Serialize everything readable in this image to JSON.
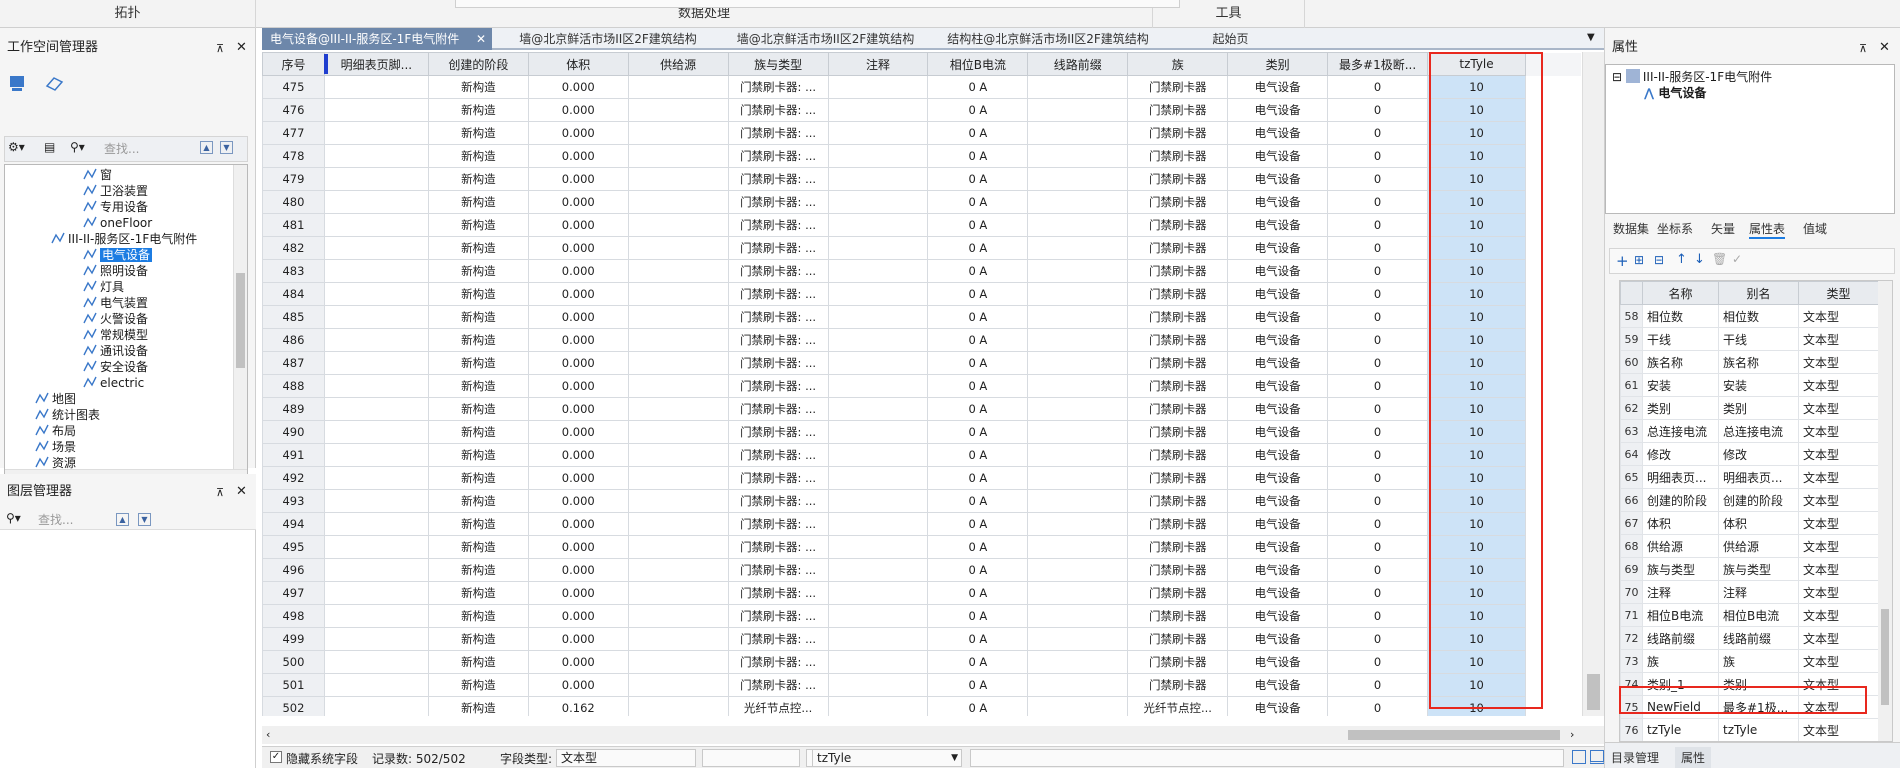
{
  "ribbon": {
    "group1": "拓扑",
    "group2": "数据处理",
    "group3": "工具"
  },
  "workspace": {
    "title": "工作空间管理器",
    "search_placeholder": "查找...",
    "tree": {
      "items_top": [
        "窗",
        "卫浴装置",
        "专用设备",
        "oneFloor"
      ],
      "dataset": "III-II-服务区-1F电气附件",
      "children": [
        "电气设备",
        "照明设备",
        "灯具",
        "电气装置",
        "火警设备",
        "常规模型",
        "通讯设备",
        "安全设备",
        "electric"
      ],
      "roots": [
        "地图",
        "统计图表",
        "布局",
        "场景",
        "资源"
      ]
    }
  },
  "layers": {
    "title": "图层管理器",
    "search_placeholder": "查找..."
  },
  "tabs": [
    "电气设备@III-II-服务区-1F电气附件",
    "墙@北京鲜活市场II区2F建筑结构",
    "墙@北京鲜活市场II区2F建筑结构",
    "结构柱@北京鲜活市场II区2F建筑结构",
    "起始页"
  ],
  "grid": {
    "headers": [
      "序号",
      "明细表页脚...",
      "创建的阶段",
      "体积",
      "供给源",
      "族与类型",
      "注释",
      "相位B电流",
      "线路前缀",
      "族",
      "类别",
      "最多#1极断...",
      "tzTyle"
    ],
    "rows": [
      [
        "475",
        "",
        "新构造",
        "0.000",
        "",
        "门禁刷卡器: ...",
        "",
        "0 A",
        "",
        "门禁刷卡器",
        "电气设备",
        "0",
        "10"
      ],
      [
        "476",
        "",
        "新构造",
        "0.000",
        "",
        "门禁刷卡器: ...",
        "",
        "0 A",
        "",
        "门禁刷卡器",
        "电气设备",
        "0",
        "10"
      ],
      [
        "477",
        "",
        "新构造",
        "0.000",
        "",
        "门禁刷卡器: ...",
        "",
        "0 A",
        "",
        "门禁刷卡器",
        "电气设备",
        "0",
        "10"
      ],
      [
        "478",
        "",
        "新构造",
        "0.000",
        "",
        "门禁刷卡器: ...",
        "",
        "0 A",
        "",
        "门禁刷卡器",
        "电气设备",
        "0",
        "10"
      ],
      [
        "479",
        "",
        "新构造",
        "0.000",
        "",
        "门禁刷卡器: ...",
        "",
        "0 A",
        "",
        "门禁刷卡器",
        "电气设备",
        "0",
        "10"
      ],
      [
        "480",
        "",
        "新构造",
        "0.000",
        "",
        "门禁刷卡器: ...",
        "",
        "0 A",
        "",
        "门禁刷卡器",
        "电气设备",
        "0",
        "10"
      ],
      [
        "481",
        "",
        "新构造",
        "0.000",
        "",
        "门禁刷卡器: ...",
        "",
        "0 A",
        "",
        "门禁刷卡器",
        "电气设备",
        "0",
        "10"
      ],
      [
        "482",
        "",
        "新构造",
        "0.000",
        "",
        "门禁刷卡器: ...",
        "",
        "0 A",
        "",
        "门禁刷卡器",
        "电气设备",
        "0",
        "10"
      ],
      [
        "483",
        "",
        "新构造",
        "0.000",
        "",
        "门禁刷卡器: ...",
        "",
        "0 A",
        "",
        "门禁刷卡器",
        "电气设备",
        "0",
        "10"
      ],
      [
        "484",
        "",
        "新构造",
        "0.000",
        "",
        "门禁刷卡器: ...",
        "",
        "0 A",
        "",
        "门禁刷卡器",
        "电气设备",
        "0",
        "10"
      ],
      [
        "485",
        "",
        "新构造",
        "0.000",
        "",
        "门禁刷卡器: ...",
        "",
        "0 A",
        "",
        "门禁刷卡器",
        "电气设备",
        "0",
        "10"
      ],
      [
        "486",
        "",
        "新构造",
        "0.000",
        "",
        "门禁刷卡器: ...",
        "",
        "0 A",
        "",
        "门禁刷卡器",
        "电气设备",
        "0",
        "10"
      ],
      [
        "487",
        "",
        "新构造",
        "0.000",
        "",
        "门禁刷卡器: ...",
        "",
        "0 A",
        "",
        "门禁刷卡器",
        "电气设备",
        "0",
        "10"
      ],
      [
        "488",
        "",
        "新构造",
        "0.000",
        "",
        "门禁刷卡器: ...",
        "",
        "0 A",
        "",
        "门禁刷卡器",
        "电气设备",
        "0",
        "10"
      ],
      [
        "489",
        "",
        "新构造",
        "0.000",
        "",
        "门禁刷卡器: ...",
        "",
        "0 A",
        "",
        "门禁刷卡器",
        "电气设备",
        "0",
        "10"
      ],
      [
        "490",
        "",
        "新构造",
        "0.000",
        "",
        "门禁刷卡器: ...",
        "",
        "0 A",
        "",
        "门禁刷卡器",
        "电气设备",
        "0",
        "10"
      ],
      [
        "491",
        "",
        "新构造",
        "0.000",
        "",
        "门禁刷卡器: ...",
        "",
        "0 A",
        "",
        "门禁刷卡器",
        "电气设备",
        "0",
        "10"
      ],
      [
        "492",
        "",
        "新构造",
        "0.000",
        "",
        "门禁刷卡器: ...",
        "",
        "0 A",
        "",
        "门禁刷卡器",
        "电气设备",
        "0",
        "10"
      ],
      [
        "493",
        "",
        "新构造",
        "0.000",
        "",
        "门禁刷卡器: ...",
        "",
        "0 A",
        "",
        "门禁刷卡器",
        "电气设备",
        "0",
        "10"
      ],
      [
        "494",
        "",
        "新构造",
        "0.000",
        "",
        "门禁刷卡器: ...",
        "",
        "0 A",
        "",
        "门禁刷卡器",
        "电气设备",
        "0",
        "10"
      ],
      [
        "495",
        "",
        "新构造",
        "0.000",
        "",
        "门禁刷卡器: ...",
        "",
        "0 A",
        "",
        "门禁刷卡器",
        "电气设备",
        "0",
        "10"
      ],
      [
        "496",
        "",
        "新构造",
        "0.000",
        "",
        "门禁刷卡器: ...",
        "",
        "0 A",
        "",
        "门禁刷卡器",
        "电气设备",
        "0",
        "10"
      ],
      [
        "497",
        "",
        "新构造",
        "0.000",
        "",
        "门禁刷卡器: ...",
        "",
        "0 A",
        "",
        "门禁刷卡器",
        "电气设备",
        "0",
        "10"
      ],
      [
        "498",
        "",
        "新构造",
        "0.000",
        "",
        "门禁刷卡器: ...",
        "",
        "0 A",
        "",
        "门禁刷卡器",
        "电气设备",
        "0",
        "10"
      ],
      [
        "499",
        "",
        "新构造",
        "0.000",
        "",
        "门禁刷卡器: ...",
        "",
        "0 A",
        "",
        "门禁刷卡器",
        "电气设备",
        "0",
        "10"
      ],
      [
        "500",
        "",
        "新构造",
        "0.000",
        "",
        "门禁刷卡器: ...",
        "",
        "0 A",
        "",
        "门禁刷卡器",
        "电气设备",
        "0",
        "10"
      ],
      [
        "501",
        "",
        "新构造",
        "0.000",
        "",
        "门禁刷卡器: ...",
        "",
        "0 A",
        "",
        "门禁刷卡器",
        "电气设备",
        "0",
        "10"
      ],
      [
        "502",
        "",
        "新构造",
        "0.162",
        "",
        "光纤节点控...",
        "",
        "0 A",
        "",
        "光纤节点控...",
        "电气设备",
        "0",
        "10"
      ]
    ]
  },
  "props": {
    "title": "属性",
    "tree_parent": "III-II-服务区-1F电气附件",
    "tree_child": "电气设备",
    "subtabs": [
      "数据集",
      "坐标系",
      "矢量",
      "属性表",
      "值域"
    ],
    "table_headers": [
      "名称",
      "别名",
      "类型"
    ],
    "rows": [
      [
        "58",
        "相位数",
        "相位数",
        "文本型"
      ],
      [
        "59",
        "干线",
        "干线",
        "文本型"
      ],
      [
        "60",
        "族名称",
        "族名称",
        "文本型"
      ],
      [
        "61",
        "安装",
        "安装",
        "文本型"
      ],
      [
        "62",
        "类别",
        "类别",
        "文本型"
      ],
      [
        "63",
        "总连接电流",
        "总连接电流",
        "文本型"
      ],
      [
        "64",
        "修改",
        "修改",
        "文本型"
      ],
      [
        "65",
        "明细表页...",
        "明细表页...",
        "文本型"
      ],
      [
        "66",
        "创建的阶段",
        "创建的阶段",
        "文本型"
      ],
      [
        "67",
        "体积",
        "体积",
        "文本型"
      ],
      [
        "68",
        "供给源",
        "供给源",
        "文本型"
      ],
      [
        "69",
        "族与类型",
        "族与类型",
        "文本型"
      ],
      [
        "70",
        "注释",
        "注释",
        "文本型"
      ],
      [
        "71",
        "相位B电流",
        "相位B电流",
        "文本型"
      ],
      [
        "72",
        "线路前缀",
        "线路前缀",
        "文本型"
      ],
      [
        "73",
        "族",
        "族",
        "文本型"
      ],
      [
        "74",
        "类别_1",
        "类别",
        "文本型"
      ],
      [
        "75",
        "NewField",
        "最多#1极...",
        "文本型"
      ],
      [
        "76",
        "tzTyle",
        "tzTyle",
        "文本型"
      ]
    ],
    "bottom_tabs": [
      "目录管理",
      "属性"
    ]
  },
  "status": {
    "hide_system": "隐藏系统字段",
    "record_count": "记录数:  502/502",
    "field_type_label": "字段类型:",
    "field_type_value": "文本型",
    "field_name": "tzTyle"
  },
  "colors": {
    "highlight": "#e8281e",
    "selection": "#1c7ce2",
    "column_fill": "#cde3f7",
    "active_tab": "#6d87aa"
  }
}
